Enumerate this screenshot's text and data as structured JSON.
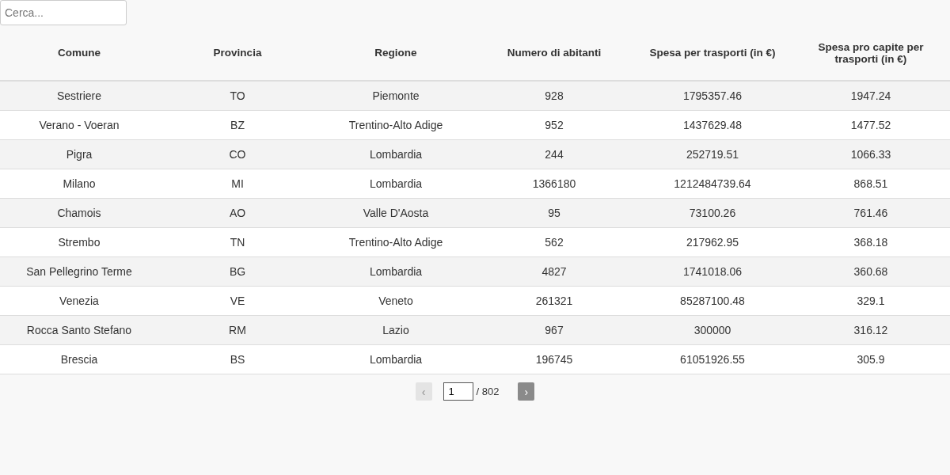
{
  "search": {
    "placeholder": "Cerca..."
  },
  "table": {
    "columns": [
      "Comune",
      "Provincia",
      "Regione",
      "Numero di abitanti",
      "Spesa per trasporti (in €)",
      "Spesa pro capite per trasporti (in €)"
    ],
    "rows": [
      [
        "Sestriere",
        "TO",
        "Piemonte",
        "928",
        "1795357.46",
        "1947.24"
      ],
      [
        "Verano - Voeran",
        "BZ",
        "Trentino-Alto Adige",
        "952",
        "1437629.48",
        "1477.52"
      ],
      [
        "Pigra",
        "CO",
        "Lombardia",
        "244",
        "252719.51",
        "1066.33"
      ],
      [
        "Milano",
        "MI",
        "Lombardia",
        "1366180",
        "1212484739.64",
        "868.51"
      ],
      [
        "Chamois",
        "AO",
        "Valle D'Aosta",
        "95",
        "73100.26",
        "761.46"
      ],
      [
        "Strembo",
        "TN",
        "Trentino-Alto Adige",
        "562",
        "217962.95",
        "368.18"
      ],
      [
        "San Pellegrino Terme",
        "BG",
        "Lombardia",
        "4827",
        "1741018.06",
        "360.68"
      ],
      [
        "Venezia",
        "VE",
        "Veneto",
        "261321",
        "85287100.48",
        "329.1"
      ],
      [
        "Rocca Santo Stefano",
        "RM",
        "Lazio",
        "967",
        "300000",
        "316.12"
      ],
      [
        "Brescia",
        "BS",
        "Lombardia",
        "196745",
        "61051926.55",
        "305.9"
      ]
    ]
  },
  "pagination": {
    "previous": {
      "label": "‹",
      "disabled": true
    },
    "page": "1",
    "total": "/ 802",
    "next": {
      "label": "›",
      "disabled": false
    }
  }
}
